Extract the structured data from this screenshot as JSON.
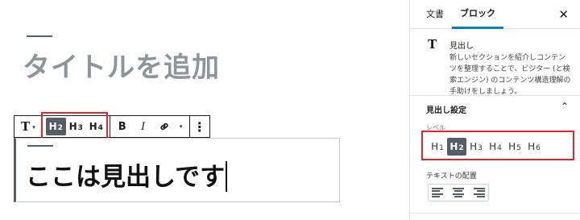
{
  "editor": {
    "post_title": "タイトルを追加",
    "heading_content": "ここは見出しです"
  },
  "toolbar": {
    "block_type_icon": "T",
    "block_type_caret": "▾",
    "headings": [
      {
        "letter": "H",
        "level": "2",
        "active": true
      },
      {
        "letter": "H",
        "level": "3",
        "active": false
      },
      {
        "letter": "H",
        "level": "4",
        "active": false
      }
    ],
    "bold_label": "B",
    "italic_label": "I",
    "link_icon": "link-icon",
    "more_caret": "▾",
    "more_options_icon": "⋮"
  },
  "sidebar": {
    "tabs": [
      {
        "label": "文書",
        "active": false
      },
      {
        "label": "ブロック",
        "active": true
      }
    ],
    "close_label": "✕",
    "block_card": {
      "icon": "T",
      "title": "見出し",
      "description": "新しいセクションを紹介しコンテンツを整理することで、ビジター (と検索エンジン) のコンテンツ構造理解の手助けをしましょう。"
    },
    "heading_settings": {
      "title": "見出し設定",
      "chevron": "⌃",
      "level_label": "レベル",
      "levels": [
        {
          "letter": "H",
          "level": "1",
          "active": false
        },
        {
          "letter": "H",
          "level": "2",
          "active": true
        },
        {
          "letter": "H",
          "level": "3",
          "active": false
        },
        {
          "letter": "H",
          "level": "4",
          "active": false
        },
        {
          "letter": "H",
          "level": "5",
          "active": false
        },
        {
          "letter": "H",
          "level": "6",
          "active": false
        }
      ],
      "alignment_label": "テキストの配置"
    }
  },
  "colors": {
    "highlight_box": "#e0262d",
    "active_button": "#555d66",
    "tab_accent": "#0085ba",
    "title_placeholder": "#8d959c"
  }
}
